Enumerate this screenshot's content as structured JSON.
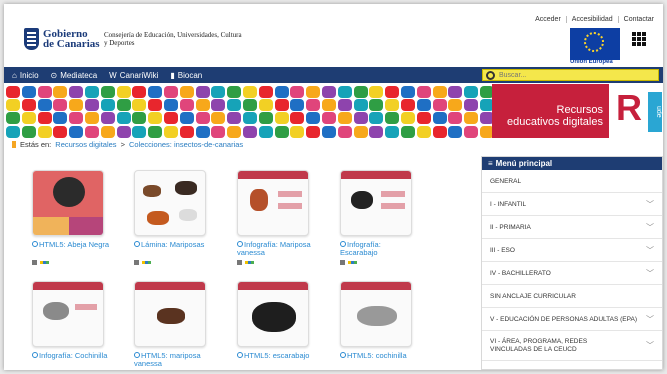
{
  "header": {
    "logo_line1": "Gobierno",
    "logo_line2": "de Canarias",
    "consejeria": "Consejería de Educación, Universidades, Cultura y Deportes",
    "top_links": [
      "Acceder",
      "Accesibilidad",
      "Contactar"
    ],
    "eu_label": "Unión Europea"
  },
  "nav": {
    "items": [
      {
        "label": "Inicio",
        "icon": "home-icon"
      },
      {
        "label": "Mediateca",
        "icon": "play-circle-icon"
      },
      {
        "label": "CanariWiki",
        "icon": "wiki-w-icon"
      },
      {
        "label": "Biocan",
        "icon": "bottle-icon"
      }
    ],
    "search_placeholder": "Buscar..."
  },
  "banner": {
    "title_line1": "Recursos",
    "title_line2": "educativos digitales",
    "vertical_text": "ude",
    "logo_letter": "R"
  },
  "breadcrumb": {
    "prefix": "Estás en:",
    "link": "Recursos digitales",
    "separator": ">",
    "current": "Colecciones: insectos-de-canarias"
  },
  "cards": [
    {
      "type": "HTML5:",
      "name": "Abeja Negra"
    },
    {
      "type": "Lámina:",
      "name": "Mariposas"
    },
    {
      "type": "Infografía:",
      "name": "Mariposa vanessa"
    },
    {
      "type": "Infografía:",
      "name": "Escarabajo"
    },
    {
      "type": "Infografía:",
      "name": "Cochinilla"
    },
    {
      "type": "HTML5:",
      "name": "mariposa vanessa"
    },
    {
      "type": "HTML5:",
      "name": "escarabajo"
    },
    {
      "type": "HTML5:",
      "name": "cochinilla"
    }
  ],
  "menu": {
    "title": "Menú principal",
    "items": [
      "GENERAL",
      "I - INFANTIL",
      "II - PRIMARIA",
      "III - ESO",
      "IV - BACHILLERATO",
      "SIN ANCLAJE CURRICULAR",
      "V - EDUCACIÓN DE PERSONAS ADULTAS (EPA)",
      "VI - ÁREA, PROGRAMA, REDES VINCULADAS DE LA CEUCD"
    ]
  },
  "colors": {
    "nav_bg": "#1e3d73",
    "accent_red": "#c6203c",
    "link_blue": "#2a8ad1",
    "search_yellow": "#f4e74b"
  }
}
